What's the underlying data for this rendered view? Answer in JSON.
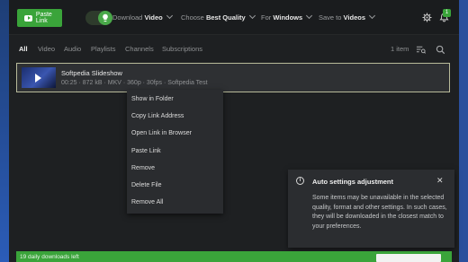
{
  "toolbar": {
    "paste_label": "Paste Link",
    "download_prefix": "Download",
    "download_value": "Video",
    "quality_prefix": "Choose",
    "quality_value": "Best Quality",
    "platform_prefix": "For",
    "platform_value": "Windows",
    "save_prefix": "Save to",
    "save_value": "Videos",
    "notification_count": "1",
    "icons": [
      "youtube-icon",
      "lightbulb-icon",
      "settings-icon",
      "bell-icon"
    ]
  },
  "tabs": [
    "All",
    "Video",
    "Audio",
    "Playlists",
    "Channels",
    "Subscriptions"
  ],
  "item_count": "1 item",
  "item": {
    "title": "Softpedia Slideshow",
    "meta": "00:25 · 872 kB · MKV · 360p · 30fps · Softpedia Test"
  },
  "context_menu": [
    "Show in Folder",
    "Copy Link Address",
    "Open Link in Browser",
    "Paste Link",
    "Remove",
    "Delete File",
    "Remove All"
  ],
  "notice": {
    "title": "Auto settings adjustment",
    "body": "Some items may be unavailable in the selected quality, format and other settings. In such cases, they will be downloaded in the closest match to your preferences."
  },
  "footer": {
    "text": "19 daily downloads left"
  },
  "colors": {
    "accent": "#3aa43a",
    "background": "#1e2022",
    "row_border": "#b8ba9a"
  }
}
